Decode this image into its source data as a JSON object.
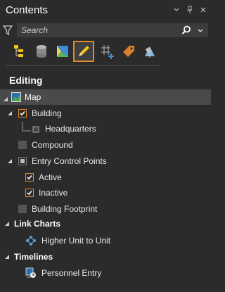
{
  "pane": {
    "title": "Contents",
    "window_controls": [
      "chevron-down-icon",
      "pin-icon",
      "close-icon"
    ]
  },
  "search": {
    "placeholder": "Search"
  },
  "toolbar": {
    "buttons": [
      {
        "name": "list-by-drawing-order-icon"
      },
      {
        "name": "list-by-data-source-icon"
      },
      {
        "name": "list-by-selection-icon"
      },
      {
        "name": "list-by-editing-icon",
        "active": true
      },
      {
        "name": "list-by-snapping-icon"
      },
      {
        "name": "list-by-labeling-icon"
      },
      {
        "name": "list-by-perspective-imagery-icon"
      }
    ]
  },
  "heading": "Editing",
  "tree": {
    "map": "Map",
    "building": "Building",
    "headquarters": "Headquarters",
    "compound": "Compound",
    "entry_control_points": "Entry Control Points",
    "active": "Active",
    "inactive": "Inactive",
    "building_footprint": "Building Footprint"
  },
  "sections": {
    "link_charts": "Link Charts",
    "link_chart_item": "Higher Unit to Unit",
    "timelines": "Timelines",
    "timeline_item": "Personnel Entry"
  },
  "colors": {
    "accent": "#e08a2c",
    "background": "#2b2b2b",
    "selected_row": "#4a4a4a"
  }
}
